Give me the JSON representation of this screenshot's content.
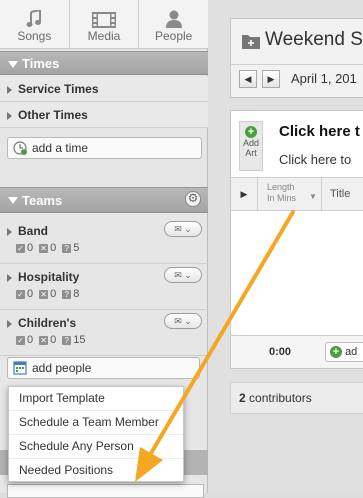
{
  "nav_tabs": [
    {
      "label": "Songs",
      "icon": "music-note-icon"
    },
    {
      "label": "Media",
      "icon": "film-icon"
    },
    {
      "label": "People",
      "icon": "person-icon"
    }
  ],
  "times": {
    "header": "Times",
    "rows": [
      "Service Times",
      "Other Times"
    ],
    "add_label": "add a time"
  },
  "teams": {
    "header": "Teams",
    "items": [
      {
        "name": "Band",
        "c1": "0",
        "c2": "0",
        "c3": "5"
      },
      {
        "name": "Hospitality",
        "c1": "0",
        "c2": "0",
        "c3": "8"
      },
      {
        "name": "Children's",
        "c1": "0",
        "c2": "0",
        "c3": "15"
      }
    ],
    "add_label": "add people"
  },
  "dropdown": {
    "items": [
      "Import Template",
      "Schedule a Team Member",
      "Schedule Any Person",
      "Needed Positions"
    ]
  },
  "plan": {
    "title": "Weekend Se",
    "date": "April 1, 201"
  },
  "order": {
    "add_art": "Add Art",
    "heading": "Click here t",
    "subheading": "Click here to",
    "col_length_line1": "Length",
    "col_length_line2": "In Mins",
    "col_title": "Title",
    "total_time": "0:00",
    "add_button": "ad"
  },
  "contributors": {
    "count": "2",
    "label": "contributors"
  },
  "colors": {
    "arrow": "#f5a623",
    "add_green": "#4a9e3c"
  }
}
